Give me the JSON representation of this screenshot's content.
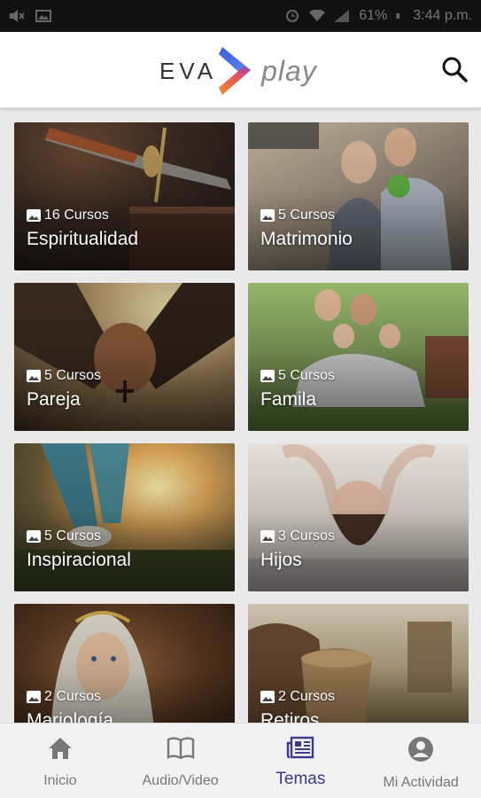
{
  "status_bar": {
    "battery": "61%",
    "time": "3:44 p.m."
  },
  "header": {
    "logo_left": "EVA",
    "logo_right": "play"
  },
  "colors": {
    "active_nav": "#3a3a8e",
    "logo_orange": "#f28c28",
    "logo_blue": "#3c5bd6",
    "logo_purple": "#8b3fc6"
  },
  "cards": [
    {
      "count": "16 Cursos",
      "title": "Espiritualidad",
      "icon": "image-icon"
    },
    {
      "count": "5 Cursos",
      "title": "Matrimonio",
      "icon": "image-icon"
    },
    {
      "count": "5 Cursos",
      "title": "Pareja",
      "icon": "image-icon"
    },
    {
      "count": "5 Cursos",
      "title": "Famila",
      "icon": "image-icon"
    },
    {
      "count": "5 Cursos",
      "title": "Inspiracional",
      "icon": "image-icon"
    },
    {
      "count": "3 Cursos",
      "title": "Hijos",
      "icon": "image-icon"
    },
    {
      "count": "2 Cursos",
      "title": "Mariología",
      "icon": "image-icon"
    },
    {
      "count": "2 Cursos",
      "title": "Retiros",
      "icon": "image-icon"
    }
  ],
  "bottom_nav": [
    {
      "label": "Inicio",
      "icon": "home-icon"
    },
    {
      "label": "Audio/Video",
      "icon": "book-icon"
    },
    {
      "label": "Temas",
      "icon": "newspaper-icon",
      "active": true
    },
    {
      "label": "Mi Actividad",
      "icon": "account-icon"
    }
  ]
}
